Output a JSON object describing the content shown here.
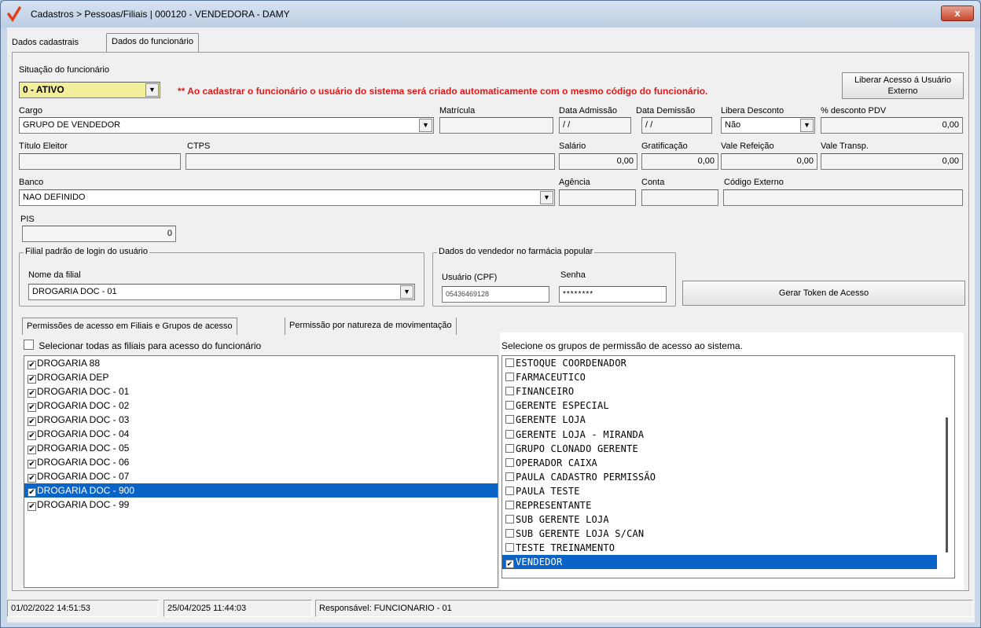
{
  "window": {
    "title": "Cadastros > Pessoas/Filiais | 000120 - VENDEDORA - DAMY",
    "close_label": "x"
  },
  "tabs": {
    "dados_cadastrais": "Dados cadastrais",
    "dados_funcionario": "Dados do funcionário"
  },
  "form": {
    "situacao_label": "Situação do funcionário",
    "situacao_value": "0 - ATIVO",
    "warning": "** Ao cadastrar o funcionário o usuário do sistema será criado automaticamente com o mesmo código do funcionário.",
    "liberar_acesso_button": "Liberar Acesso á Usuário Externo",
    "cargo_label": "Cargo",
    "cargo_value": "GRUPO DE VENDEDOR",
    "matricula_label": "Matrícula",
    "matricula_value": "",
    "data_admissao_label": "Data Admissão",
    "data_admissao_value": " / /",
    "data_demissao_label": "Data Demissão",
    "data_demissao_value": " / /",
    "libera_desconto_label": "Libera Desconto",
    "libera_desconto_value": "Não",
    "desconto_pdv_label": "% desconto PDV",
    "desconto_pdv_value": "0,00",
    "titulo_eleitor_label": "Título Eleitor",
    "ctps_label": "CTPS",
    "salario_label": "Salário",
    "salario_value": "0,00",
    "gratificacao_label": "Gratificação",
    "gratificacao_value": "0,00",
    "vale_refeicao_label": "Vale Refeição",
    "vale_refeicao_value": "0,00",
    "vale_transp_label": "Vale Transp.",
    "vale_transp_value": "0,00",
    "banco_label": "Banco",
    "banco_value": "NAO DEFINIDO",
    "agencia_label": "Agência",
    "conta_label": "Conta",
    "codigo_externo_label": "Código Externo",
    "pis_label": "PIS",
    "pis_value": "0",
    "filial_group_title": "Filial padrão de login do usuário",
    "nome_filial_label": "Nome da filial",
    "nome_filial_value": "DROGARIA DOC - 01",
    "vendedor_group_title": "Dados do vendedor no farmácia popular",
    "usuario_cpf_label": "Usuário (CPF)",
    "usuario_cpf_value": "05436469128",
    "senha_label": "Senha",
    "senha_value": "********",
    "gerar_token_button": "Gerar Token de Acesso"
  },
  "inner_tabs": {
    "permissoes": "Permissões de acesso em Filiais e Grupos de acesso",
    "natureza": "Permissão por natureza de movimentação"
  },
  "filiais": {
    "select_all_label": "Selecionar todas as filiais para acesso do funcionário",
    "items": [
      "DROGARIA 88",
      "DROGARIA DEP",
      "DROGARIA DOC - 01",
      "DROGARIA DOC - 02",
      "DROGARIA DOC - 03",
      "DROGARIA DOC - 04",
      "DROGARIA DOC - 05",
      "DROGARIA DOC - 06",
      "DROGARIA DOC - 07",
      "DROGARIA DOC - 900",
      "DROGARIA DOC - 99"
    ]
  },
  "grupos": {
    "title": "Selecione os grupos de permissão de acesso ao sistema.",
    "items": [
      "ESTOQUE COORDENADOR",
      "FARMACEUTICO",
      "FINANCEIRO",
      "GERENTE ESPECIAL",
      "GERENTE LOJA",
      "GERENTE LOJA - MIRANDA",
      "GRUPO CLONADO GERENTE",
      "OPERADOR CAIXA",
      "PAULA CADASTRO PERMISSÃO",
      "PAULA TESTE",
      "REPRESENTANTE",
      "SUB GERENTE LOJA",
      "SUB GERENTE LOJA S/CAN",
      "TESTE TREINAMENTO",
      "VENDEDOR"
    ]
  },
  "status": {
    "created": "01/02/2022 14:51:53",
    "updated": "25/04/2025 11:44:03",
    "responsavel": "Responsável: FUNCIONARIO - 01"
  }
}
